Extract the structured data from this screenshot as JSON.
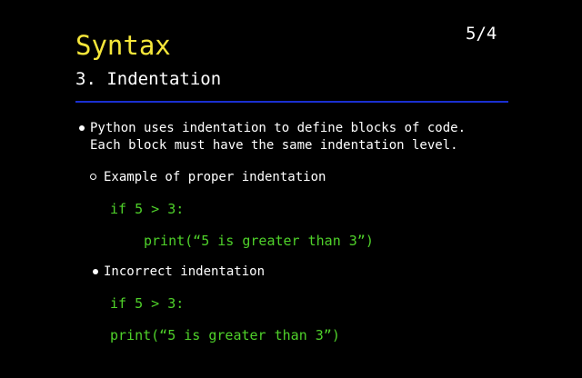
{
  "slide": {
    "title": "Syntax",
    "page_number": "5/4",
    "subtitle": "3. Indentation",
    "rule_color": "#1a2fd1",
    "accent_title_color": "#f5e63a",
    "code_color": "#4fd12a"
  },
  "bullets": {
    "main_line1": "Python uses indentation to define blocks of code.",
    "main_line2": "Each block must have the same indentation level.",
    "proper_label": "Example of proper indentation",
    "proper_code_line1": "if 5 > 3:",
    "proper_code_line2": "print(“5 is greater than 3”)",
    "incorrect_label": "Incorrect indentation",
    "incorrect_code_line1": "if 5 > 3:",
    "incorrect_code_line2": "print(“5 is greater than 3”)"
  },
  "icons": {
    "main_bullet": "filled-dot-bullet",
    "proper_bullet": "hollow-circle-bullet",
    "incorrect_bullet": "filled-dot-bullet"
  }
}
